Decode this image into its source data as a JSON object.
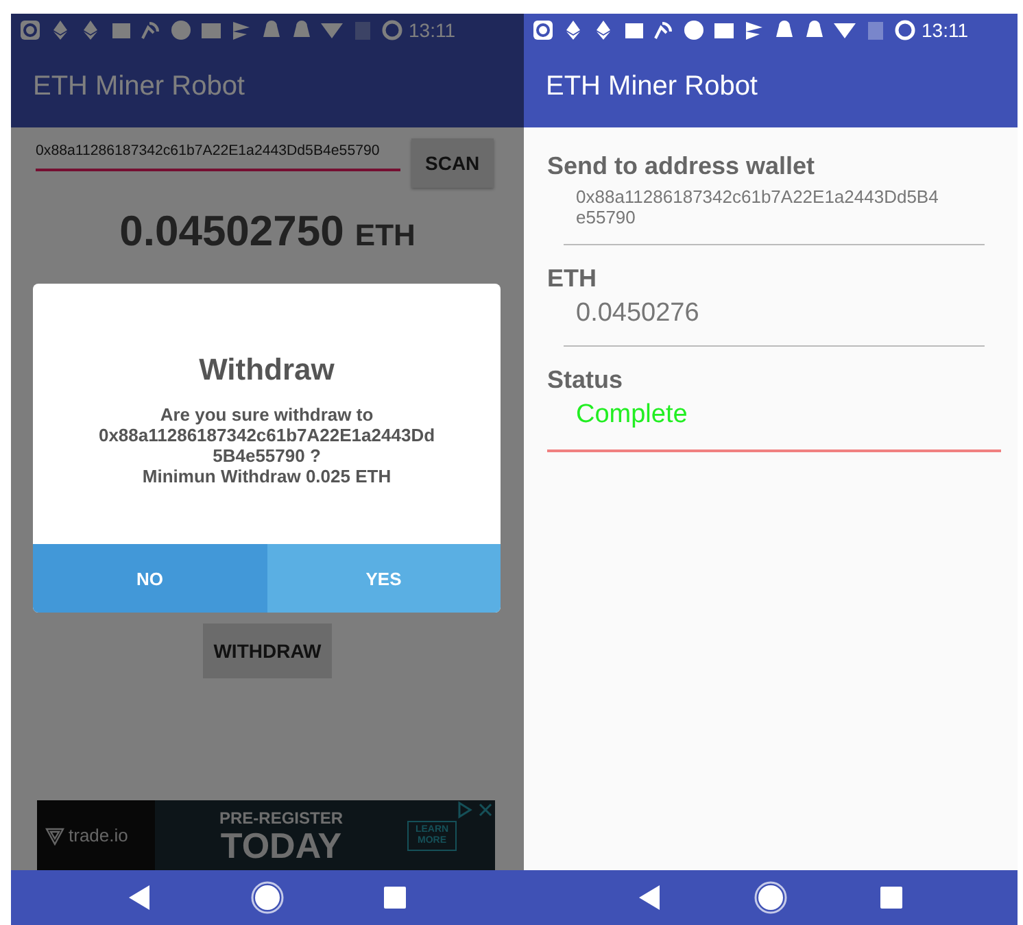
{
  "left_screen": {
    "status_bar": {
      "time": "13:11"
    },
    "app_bar": {
      "title": "ETH Miner Robot"
    },
    "address_field": {
      "value": "0x88a11286187342c61b7A22E1a2443Dd5B4e55790"
    },
    "scan_button": "SCAN",
    "balance": {
      "amount": "0.04502750",
      "unit": "ETH"
    },
    "withdraw_button": "WITHDRAW",
    "ad": {
      "brand": "trade.io",
      "headline": "PRE-REGISTER",
      "big_text": "TODAY",
      "cta": "LEARN MORE"
    },
    "dialog": {
      "title": "Withdraw",
      "message_lines": [
        "Are you sure withdraw to",
        "0x88a11286187342c61b7A22E1a2443Dd",
        "5B4e55790 ?",
        "Minimun Withdraw 0.025 ETH"
      ],
      "buttons": [
        {
          "label": "NO",
          "pressed": true
        },
        {
          "label": "YES",
          "pressed": false
        }
      ]
    }
  },
  "right_screen": {
    "status_bar": {
      "time": "13:11"
    },
    "app_bar": {
      "title": "ETH Miner Robot"
    },
    "fields": [
      {
        "label": "Send to address wallet",
        "value": "0x88a11286187342c61b7A22E1a2443Dd5B4\ne55790",
        "kind": "address"
      },
      {
        "label": "ETH",
        "value": "0.0450276",
        "kind": "amount"
      },
      {
        "label": "Status",
        "value": "Complete",
        "kind": "status"
      }
    ]
  }
}
